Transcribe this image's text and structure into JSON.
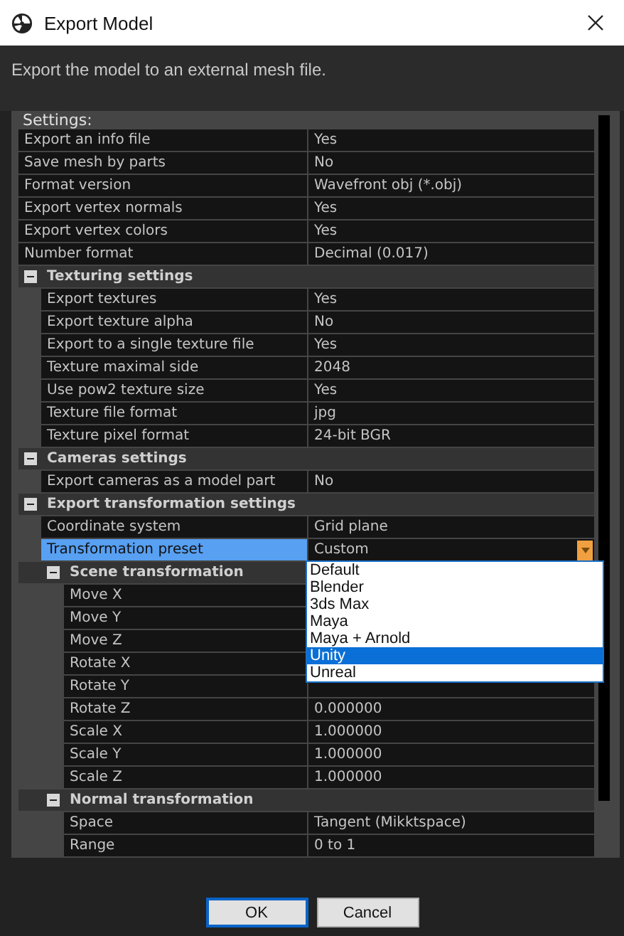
{
  "window": {
    "title": "Export Model"
  },
  "description": "Export the model to an external mesh file.",
  "settings": {
    "title": "Settings:",
    "items": [
      {
        "kind": "property",
        "label": "Export an info file",
        "value": "Yes",
        "selected": false
      },
      {
        "kind": "property",
        "label": "Save mesh by parts",
        "value": "No",
        "selected": false
      },
      {
        "kind": "property",
        "label": "Format version",
        "value": "Wavefront obj (*.obj)",
        "selected": false
      },
      {
        "kind": "property",
        "label": "Export vertex normals",
        "value": "Yes",
        "selected": false
      },
      {
        "kind": "property",
        "label": "Export vertex colors",
        "value": "Yes",
        "selected": false
      },
      {
        "kind": "property",
        "label": "Number format",
        "value": "Decimal (0.017)",
        "selected": false
      },
      {
        "kind": "group",
        "label": "Texturing settings",
        "expanded": true,
        "children": [
          {
            "kind": "property",
            "label": "Export textures",
            "value": "Yes",
            "selected": false
          },
          {
            "kind": "property",
            "label": "Export texture alpha",
            "value": "No",
            "selected": false
          },
          {
            "kind": "property",
            "label": "Export to a single texture file",
            "value": "Yes",
            "selected": false
          },
          {
            "kind": "property",
            "label": "Texture maximal side",
            "value": "2048",
            "selected": false
          },
          {
            "kind": "property",
            "label": "Use pow2 texture size",
            "value": "Yes",
            "selected": false
          },
          {
            "kind": "property",
            "label": "Texture file format",
            "value": "jpg",
            "selected": false
          },
          {
            "kind": "property",
            "label": "Texture pixel format",
            "value": "24-bit BGR",
            "selected": false
          }
        ]
      },
      {
        "kind": "group",
        "label": "Cameras settings",
        "expanded": true,
        "children": [
          {
            "kind": "property",
            "label": "Export cameras as a model part",
            "value": "No",
            "selected": false
          }
        ]
      },
      {
        "kind": "group",
        "label": "Export transformation settings",
        "expanded": true,
        "children": [
          {
            "kind": "property",
            "label": "Coordinate system",
            "value": "Grid plane",
            "selected": false
          },
          {
            "kind": "combo",
            "label": "Transformation preset",
            "value": "Custom",
            "selected": true,
            "open": true,
            "options": [
              {
                "label": "Default",
                "selected": false
              },
              {
                "label": "Blender",
                "selected": false
              },
              {
                "label": "3ds Max",
                "selected": false
              },
              {
                "label": "Maya",
                "selected": false
              },
              {
                "label": "Maya + Arnold",
                "selected": false
              },
              {
                "label": "Unity",
                "selected": true
              },
              {
                "label": "Unreal",
                "selected": false
              }
            ]
          },
          {
            "kind": "group",
            "label": "Scene transformation",
            "expanded": true,
            "children": [
              {
                "kind": "property",
                "label": "Move X",
                "selected": false
              },
              {
                "kind": "property",
                "label": "Move Y",
                "selected": false
              },
              {
                "kind": "property",
                "label": "Move Z",
                "selected": false
              },
              {
                "kind": "property",
                "label": "Rotate X",
                "selected": false
              },
              {
                "kind": "property",
                "label": "Rotate Y",
                "selected": false
              },
              {
                "kind": "property",
                "label": "Rotate Z",
                "value": "0.000000",
                "selected": false
              },
              {
                "kind": "property",
                "label": "Scale X",
                "value": "1.000000",
                "selected": false
              },
              {
                "kind": "property",
                "label": "Scale Y",
                "value": "1.000000",
                "selected": false
              },
              {
                "kind": "property",
                "label": "Scale Z",
                "value": "1.000000",
                "selected": false
              }
            ]
          },
          {
            "kind": "group",
            "label": "Normal transformation",
            "expanded": true,
            "children": [
              {
                "kind": "property",
                "label": "Space",
                "value": "Tangent (Mikktspace)",
                "selected": false
              },
              {
                "kind": "property",
                "label": "Range",
                "value": "0 to 1",
                "selected": false
              }
            ]
          }
        ]
      }
    ]
  },
  "buttons": [
    {
      "label": "OK",
      "default": true
    },
    {
      "label": "Cancel",
      "default": false
    }
  ]
}
